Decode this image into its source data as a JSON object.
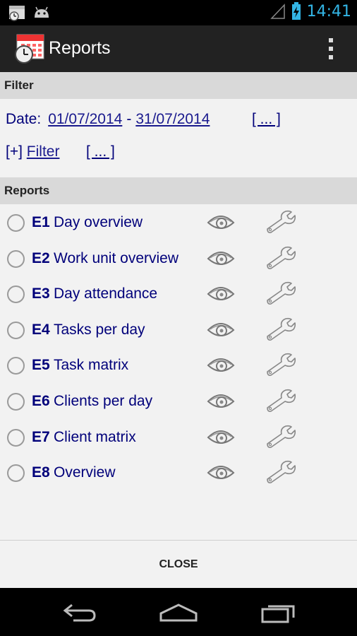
{
  "status_bar": {
    "time": "14:41",
    "icons": [
      "calendar-clock-icon",
      "android-icon",
      "signal-icon",
      "battery-charging-icon"
    ]
  },
  "action_bar": {
    "title": "Reports",
    "icon": "calendar-clock-icon",
    "overflow_icon": "overflow-menu-icon"
  },
  "filter": {
    "header": "Filter",
    "date_label": "Date:",
    "date_from": "01/07/2014",
    "date_separator": "-",
    "date_to": "31/07/2014",
    "date_more": "[ ... ]",
    "filter_toggle": "[+]",
    "filter_link": "Filter",
    "filter_more": "[ ... ]"
  },
  "reports": {
    "header": "Reports",
    "items": [
      {
        "code": "E1",
        "name": "Day overview"
      },
      {
        "code": "E2",
        "name": "Work unit overview"
      },
      {
        "code": "E3",
        "name": "Day attendance"
      },
      {
        "code": "E4",
        "name": "Tasks per day"
      },
      {
        "code": "E5",
        "name": "Task matrix"
      },
      {
        "code": "E6",
        "name": "Clients per day"
      },
      {
        "code": "E7",
        "name": "Client matrix"
      },
      {
        "code": "E8",
        "name": "Overview"
      }
    ]
  },
  "footer": {
    "close_label": "CLOSE"
  },
  "nav_bar": {
    "icons": [
      "back-icon",
      "home-icon",
      "recents-icon"
    ]
  },
  "colors": {
    "link_text": "#00007a",
    "header_bg": "#d9d9d9",
    "action_bar_bg": "#222222",
    "clock": "#33b5e5"
  }
}
